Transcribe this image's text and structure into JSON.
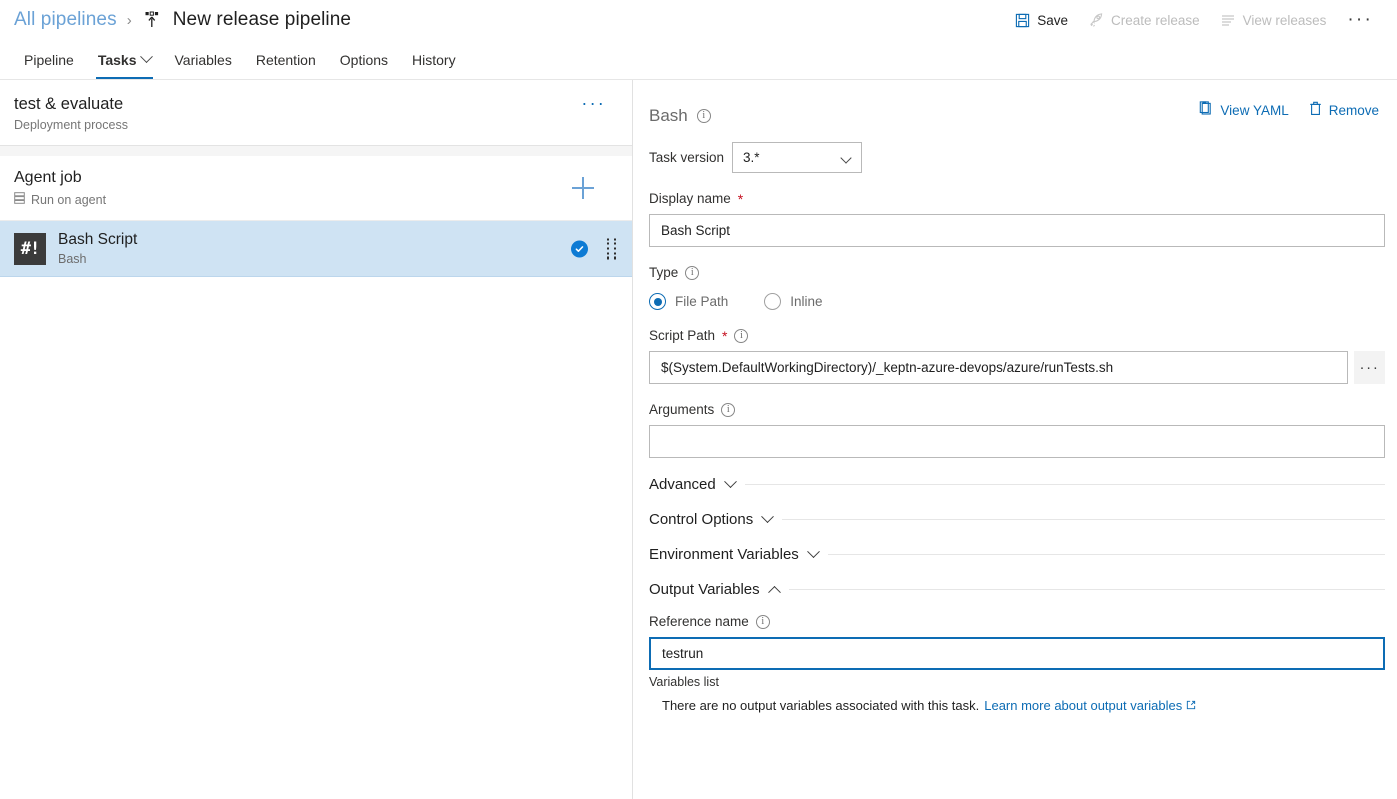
{
  "breadcrumb": {
    "root_label": "All pipelines",
    "separator": "›",
    "current_label": "New release pipeline",
    "pipeline_icon": "release-pipeline-icon"
  },
  "top_actions": [
    {
      "label": "Save",
      "icon": "save-icon",
      "enabled": true
    },
    {
      "label": "Create release",
      "icon": "rocket-icon",
      "enabled": false
    },
    {
      "label": "View releases",
      "icon": "list-icon",
      "enabled": false
    }
  ],
  "top_overflow": "···",
  "tabs": [
    {
      "label": "Pipeline",
      "active": false,
      "has_chevron": false
    },
    {
      "label": "Tasks",
      "active": true,
      "has_chevron": true
    },
    {
      "label": "Variables",
      "active": false,
      "has_chevron": false
    },
    {
      "label": "Retention",
      "active": false,
      "has_chevron": false
    },
    {
      "label": "Options",
      "active": false,
      "has_chevron": false
    },
    {
      "label": "History",
      "active": false,
      "has_chevron": false
    }
  ],
  "sidebar": {
    "process": {
      "title": "test & evaluate",
      "subtitle": "Deployment process",
      "overflow": "···"
    },
    "job": {
      "title": "Agent job",
      "subtitle": "Run on agent",
      "add_label": "+"
    },
    "task": {
      "icon_text": "#!",
      "title": "Bash Script",
      "subtitle": "Bash",
      "enabled_badge": "✓",
      "drag_handle": "drag-handle"
    }
  },
  "details": {
    "header_title": "Bash",
    "view_yaml_label": "View YAML",
    "remove_label": "Remove",
    "task_version_label": "Task version",
    "task_version_value": "3.*",
    "display_name_label": "Display name",
    "display_name_value": "Bash Script",
    "type_label": "Type",
    "type_options": [
      {
        "label": "File Path",
        "selected": true
      },
      {
        "label": "Inline",
        "selected": false
      }
    ],
    "script_path_label": "Script Path",
    "script_path_value": "$(System.DefaultWorkingDirectory)/_keptn-azure-devops/azure/runTests.sh",
    "browse_label": "···",
    "arguments_label": "Arguments",
    "arguments_value": "",
    "sections": [
      {
        "title": "Advanced",
        "expanded": false
      },
      {
        "title": "Control Options",
        "expanded": false
      },
      {
        "title": "Environment Variables",
        "expanded": false
      },
      {
        "title": "Output Variables",
        "expanded": true
      }
    ],
    "reference_name_label": "Reference name",
    "reference_name_value": "testrun",
    "variables_list_label": "Variables list",
    "no_variables_text": "There are no output variables associated with this task.",
    "learn_more_label": "Learn more about output variables"
  },
  "colors": {
    "accent": "#0d6cb4",
    "link": "#0d6cb4",
    "selected_row": "#cfe3f3",
    "required_asterisk": "#c50f1f",
    "task_icon_bg": "#3b3b3b"
  }
}
